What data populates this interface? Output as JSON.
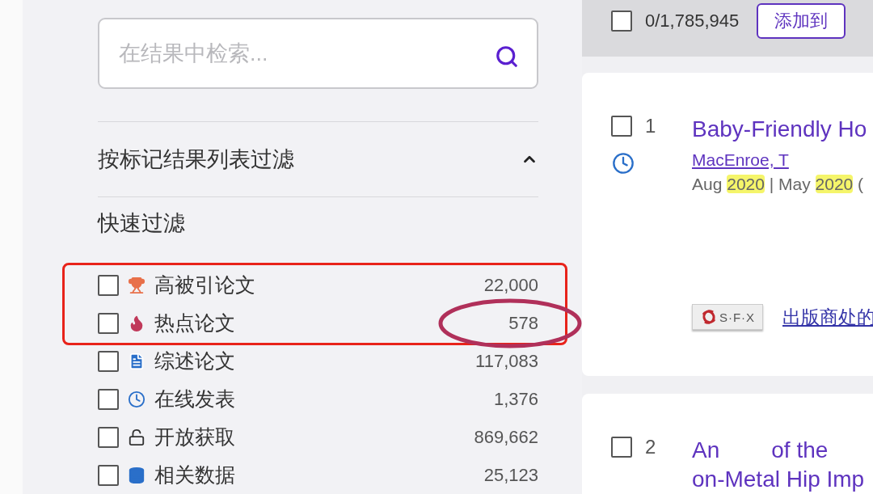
{
  "sidebar": {
    "search": {
      "placeholder": "在结果中检索..."
    },
    "section": {
      "title": "按标记结果列表过滤",
      "expanded": true
    },
    "quick_filter": {
      "title": "快速过滤",
      "items": [
        {
          "kind": "trophy",
          "label": "高被引论文",
          "count": "22,000",
          "checked": false
        },
        {
          "kind": "flame",
          "label": "热点论文",
          "count": "578",
          "checked": false
        },
        {
          "kind": "document",
          "label": "综述论文",
          "count": "117,083",
          "checked": false
        },
        {
          "kind": "clock",
          "label": "在线发表",
          "count": "1,376",
          "checked": false
        },
        {
          "kind": "lock",
          "label": "开放获取",
          "count": "869,662",
          "checked": false
        },
        {
          "kind": "database",
          "label": "相关数据",
          "count": "25,123",
          "checked": false
        }
      ],
      "annotations": [
        {
          "kind": "box"
        },
        {
          "kind": "ellipse"
        }
      ]
    }
  },
  "results_toolbar": {
    "select_all": {
      "checked": false
    },
    "selected_count": "0/1,785,945",
    "button": "添加到"
  },
  "results": [
    {
      "number": "1",
      "checked": false,
      "early_access": true,
      "title_lines": [
        [
          "Baby-Friendly Ho"
        ]
      ],
      "author": "MacEnroe, T",
      "date": [
        {
          "text": "Aug ",
          "highlight": false
        },
        {
          "text": "2020",
          "highlight": true
        },
        {
          "text": " | May ",
          "highlight": false
        },
        {
          "text": "2020",
          "highlight": true
        },
        {
          "text": " (",
          "highlight": false
        }
      ],
      "sfx": "S·F·X",
      "publisher_link": "出版商处的"
    },
    {
      "number": "2",
      "checked": false,
      "early_access": false,
      "title_lines": [
        [
          "An",
          "of the"
        ],
        [
          "on-Metal Hip Imp"
        ]
      ]
    }
  ]
}
